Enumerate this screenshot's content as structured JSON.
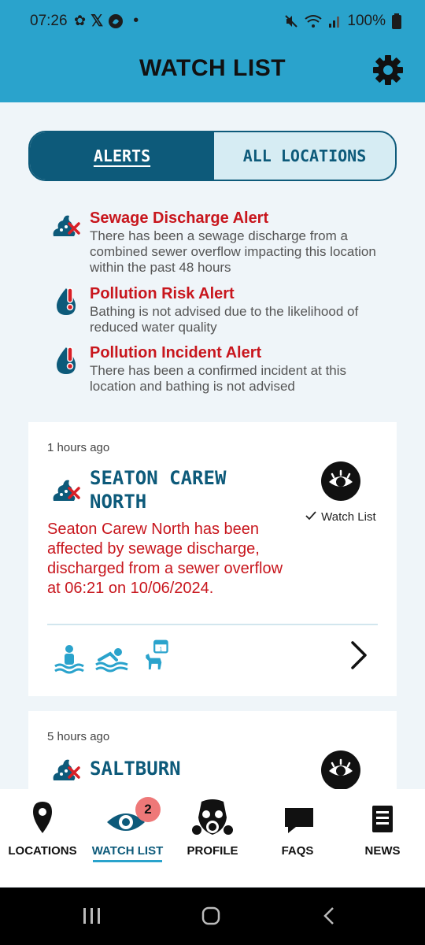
{
  "status_bar": {
    "time": "07:26",
    "battery": "100%"
  },
  "header": {
    "title": "WATCH LIST"
  },
  "tabs": {
    "alerts": "ALERTS",
    "all_locations": "ALL LOCATIONS"
  },
  "legend": [
    {
      "title": "Sewage Discharge Alert",
      "desc": "There has been a sewage discharge from a combined sewer overflow impacting this location within the past 48 hours",
      "icon": "sewage-icon"
    },
    {
      "title": "Pollution Risk Alert",
      "desc": "Bathing is not advised due to the likelihood of reduced water quality",
      "icon": "pollution-risk-icon"
    },
    {
      "title": "Pollution Incident Alert",
      "desc": "There has been a confirmed incident at this location and bathing is not advised",
      "icon": "pollution-incident-icon"
    }
  ],
  "cards": [
    {
      "time_ago": "1 hours ago",
      "location": "SEATON CAREW NORTH",
      "watch_label": "Watch List",
      "message": "Seaton Carew North has been affected by sewage discharge, discharged from a sewer overflow at 06:21 on 10/06/2024."
    },
    {
      "time_ago": "5 hours ago",
      "location": "SALTBURN"
    }
  ],
  "nav": {
    "locations": "LOCATIONS",
    "watch_list": "WATCH LIST",
    "profile": "PROFILE",
    "faqs": "FAQS",
    "news": "NEWS",
    "badge": "2"
  },
  "colors": {
    "header": "#2aa3cc",
    "primary": "#0d5a7a",
    "alert_red": "#c8161d",
    "background": "#eff5f9"
  }
}
